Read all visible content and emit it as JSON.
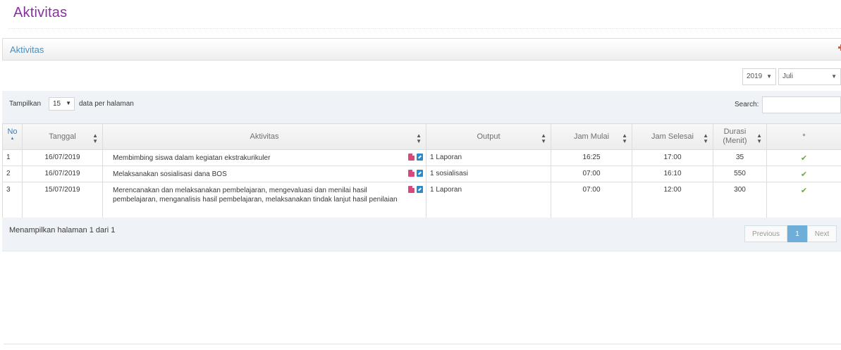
{
  "page": {
    "title": "Aktivitas"
  },
  "widget": {
    "title": "Aktivitas",
    "add_icon": "plus-icon",
    "accent": "#d15b47"
  },
  "filters": {
    "year": "2019",
    "month": "Juli"
  },
  "length": {
    "prefix": "Tampilkan",
    "value": "15",
    "suffix": "data per halaman"
  },
  "search": {
    "label": "Search:",
    "value": ""
  },
  "table": {
    "headers": {
      "no": "No",
      "tanggal": "Tanggal",
      "aktivitas": "Aktivitas",
      "output": "Output",
      "jam_mulai": "Jam Mulai",
      "jam_selesai": "Jam Selesai",
      "durasi": "Durasi (Menit)",
      "status": "*"
    },
    "rows": [
      {
        "no": "1",
        "tanggal": "16/07/2019",
        "aktivitas": "Membimbing siswa dalam kegiatan ekstrakurikuler",
        "output": "1 Laporan",
        "jam_mulai": "16:25",
        "jam_selesai": "17:00",
        "durasi": "35",
        "status_icon": "check-icon"
      },
      {
        "no": "2",
        "tanggal": "16/07/2019",
        "aktivitas": "Melaksanakan sosialisasi dana BOS",
        "output": "1 sosialisasi",
        "jam_mulai": "07:00",
        "jam_selesai": "16:10",
        "durasi": "550",
        "status_icon": "check-icon"
      },
      {
        "no": "3",
        "tanggal": "15/07/2019",
        "aktivitas": "Merencanakan dan melaksanakan pembelajaran, mengevaluasi dan menilai hasil pembelajaran, menganalisis hasil pembelajaran, melaksanakan tindak lanjut hasil penilaian",
        "output": "1 Laporan",
        "jam_mulai": "07:00",
        "jam_selesai": "12:00",
        "durasi": "300",
        "status_icon": "check-icon"
      }
    ]
  },
  "footer": {
    "info": "Menampilkan halaman 1 dari 1",
    "pagination": {
      "previous": "Previous",
      "current": "1",
      "next": "Next"
    }
  },
  "colors": {
    "title": "#8a2f9e",
    "link": "#4c8fbd",
    "active_page": "#6faed9",
    "check": "#69aa46"
  }
}
